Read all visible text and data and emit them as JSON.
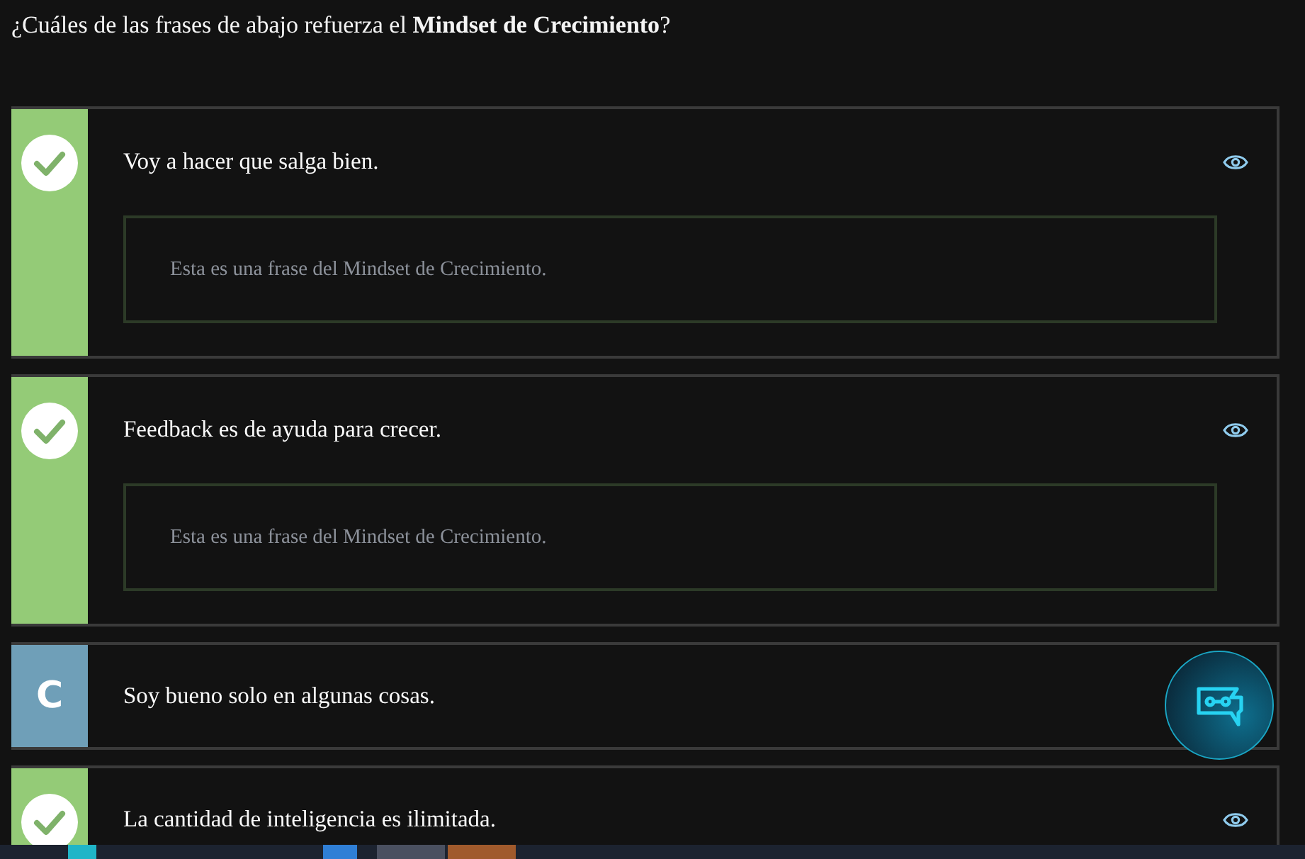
{
  "question": "¿Cuáles de las frases de abajo refuerza el **Mindset de Crecimiento**?",
  "options": [
    {
      "kind": "correct",
      "text": "Voy a hacer que salga bien.",
      "feedback": "Esta es una frase del Mindset de Crecimiento.",
      "eye": true
    },
    {
      "kind": "correct",
      "text": "Feedback es de ayuda para crecer.",
      "feedback": "Esta es una frase del Mindset de Crecimiento.",
      "eye": true
    },
    {
      "kind": "letter",
      "letter": "C",
      "text": "Soy bueno solo en algunas cosas.",
      "eye": false
    },
    {
      "kind": "correct",
      "text": "La cantidad de inteligencia es ilimitada.",
      "eye": true
    }
  ]
}
